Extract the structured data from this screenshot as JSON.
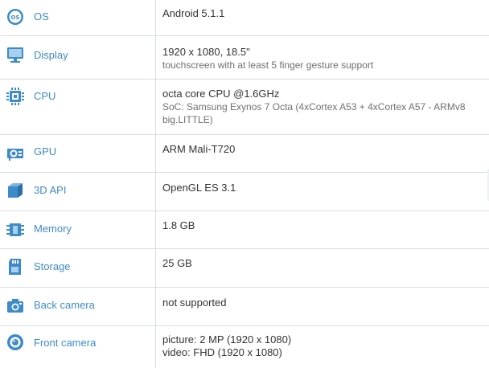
{
  "specs": [
    {
      "label": "OS",
      "icon": "os-icon",
      "lines": [
        "Android 5.1.1"
      ]
    },
    {
      "label": "Display",
      "icon": "display-icon",
      "lines": [
        "1920 x 1080, 18.5\"",
        "touchscreen with at least 5 finger gesture support"
      ]
    },
    {
      "label": "CPU",
      "icon": "cpu-icon",
      "lines": [
        "octa core CPU @1.6GHz",
        "SoC: Samsung Exynos 7 Octa (4xCortex A53 + 4xCortex A57 - ARMv8",
        "big.LITTLE)"
      ]
    },
    {
      "label": "GPU",
      "icon": "gpu-icon",
      "lines": [
        "ARM Mali-T720"
      ]
    },
    {
      "label": "3D API",
      "icon": "cube-icon",
      "lines": [
        "OpenGL ES 3.1"
      ]
    },
    {
      "label": "Memory",
      "icon": "memory-icon",
      "lines": [
        "1.8 GB"
      ]
    },
    {
      "label": "Storage",
      "icon": "storage-icon",
      "lines": [
        "25 GB"
      ]
    },
    {
      "label": "Back camera",
      "icon": "camera-icon",
      "lines": [
        "not supported"
      ]
    },
    {
      "label": "Front camera",
      "icon": "front-camera-icon",
      "lines": [
        "picture: 2 MP (1920 x 1080)",
        "video: FHD (1920 x 1080)"
      ]
    }
  ],
  "colors": {
    "label": "#3e8bc9",
    "icon": "#3e8bc9",
    "border": "#d8dde2",
    "value": "#333333",
    "sub": "#707070"
  }
}
